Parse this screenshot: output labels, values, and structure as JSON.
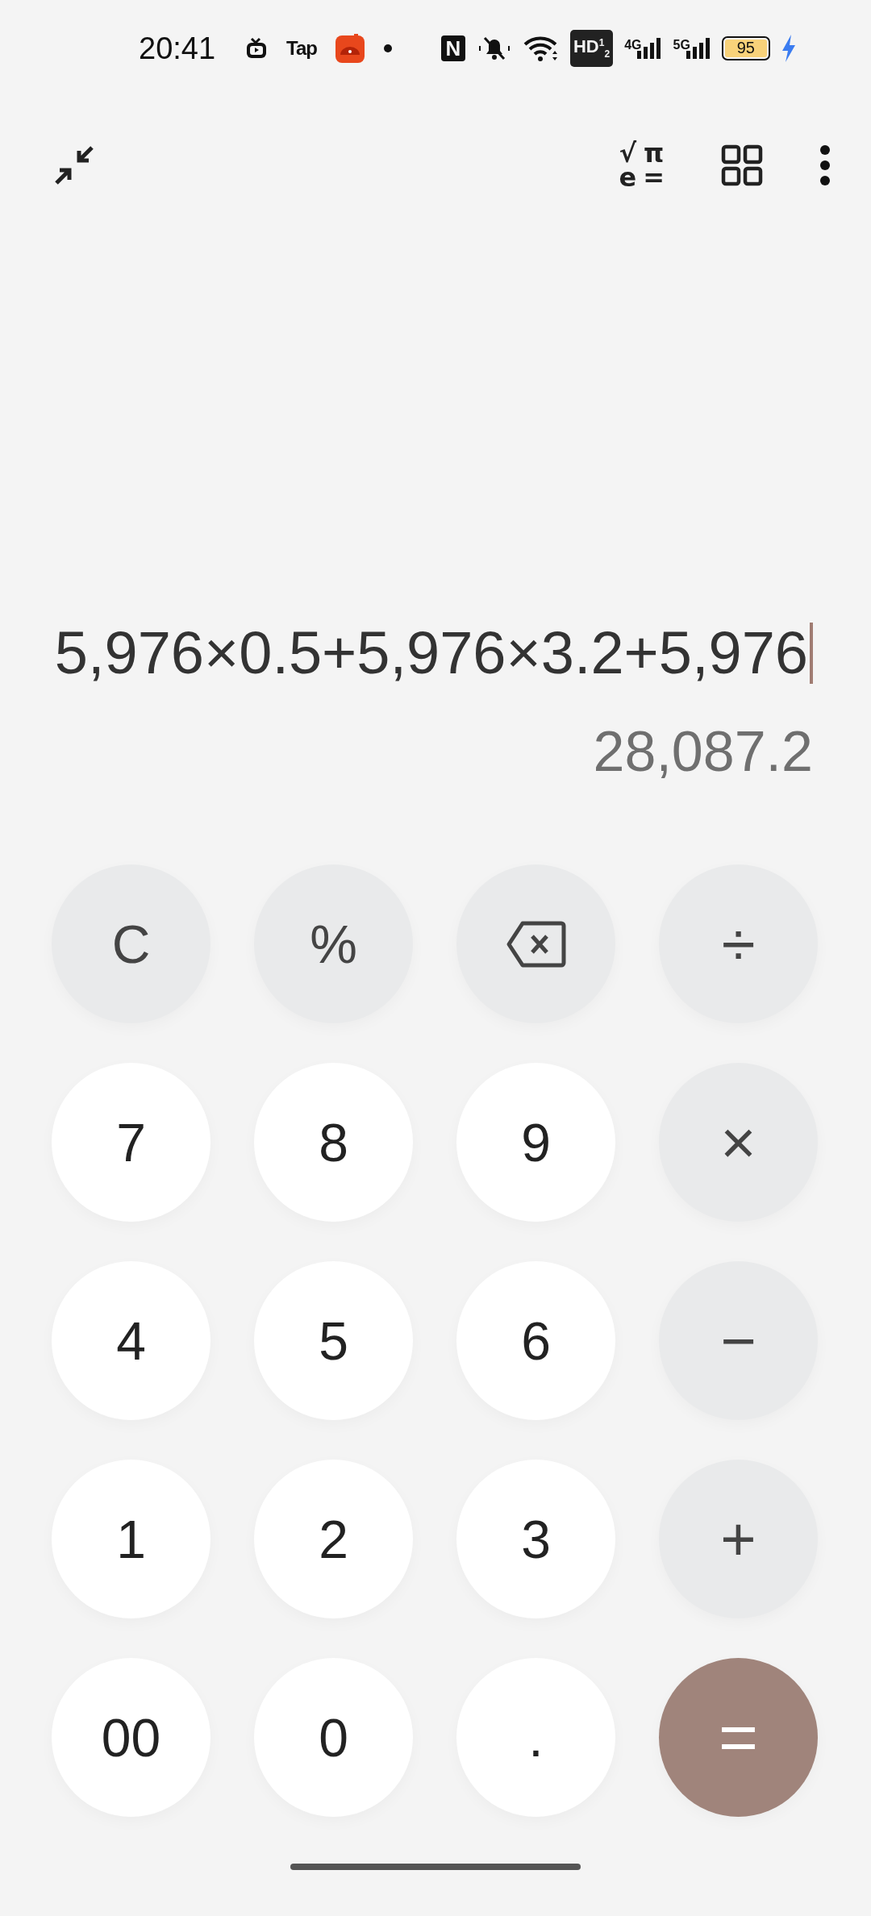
{
  "status_bar": {
    "time": "20:41",
    "app_icons": [
      {
        "kind": "tv"
      },
      {
        "kind": "text",
        "text": "Tap"
      },
      {
        "kind": "app"
      },
      {
        "kind": "dot"
      }
    ],
    "nfc": "N",
    "hd": "HD$^{1}$$_{2}$",
    "signals": [
      {
        "label": "4G"
      },
      {
        "label": "5G"
      }
    ],
    "battery": "95",
    "charging": true
  },
  "toolbar": {
    "scientific_symbols": [
      "√",
      "π",
      "e",
      "="
    ]
  },
  "display": {
    "expression": "5,976×0.5+5,976×3.2+5,976",
    "cursor": true,
    "result": "28,087.2"
  },
  "keys": [
    {
      "kind": "function",
      "label": "C"
    },
    {
      "kind": "function",
      "label": "%"
    },
    {
      "kind": "backspace"
    },
    {
      "kind": "operator",
      "label": "÷"
    },
    {
      "kind": "digit",
      "label": "7"
    },
    {
      "kind": "digit",
      "label": "8"
    },
    {
      "kind": "digit",
      "label": "9"
    },
    {
      "kind": "operator",
      "label": "×"
    },
    {
      "kind": "digit",
      "label": "4"
    },
    {
      "kind": "digit",
      "label": "5"
    },
    {
      "kind": "digit",
      "label": "6"
    },
    {
      "kind": "operator",
      "label": "−"
    },
    {
      "kind": "digit",
      "label": "1"
    },
    {
      "kind": "digit",
      "label": "2"
    },
    {
      "kind": "digit",
      "label": "3"
    },
    {
      "kind": "operator",
      "label": "+"
    },
    {
      "kind": "digit",
      "label": "00"
    },
    {
      "kind": "digit",
      "label": "0"
    },
    {
      "kind": "digit",
      "label": "."
    },
    {
      "kind": "equals",
      "label": "="
    }
  ]
}
